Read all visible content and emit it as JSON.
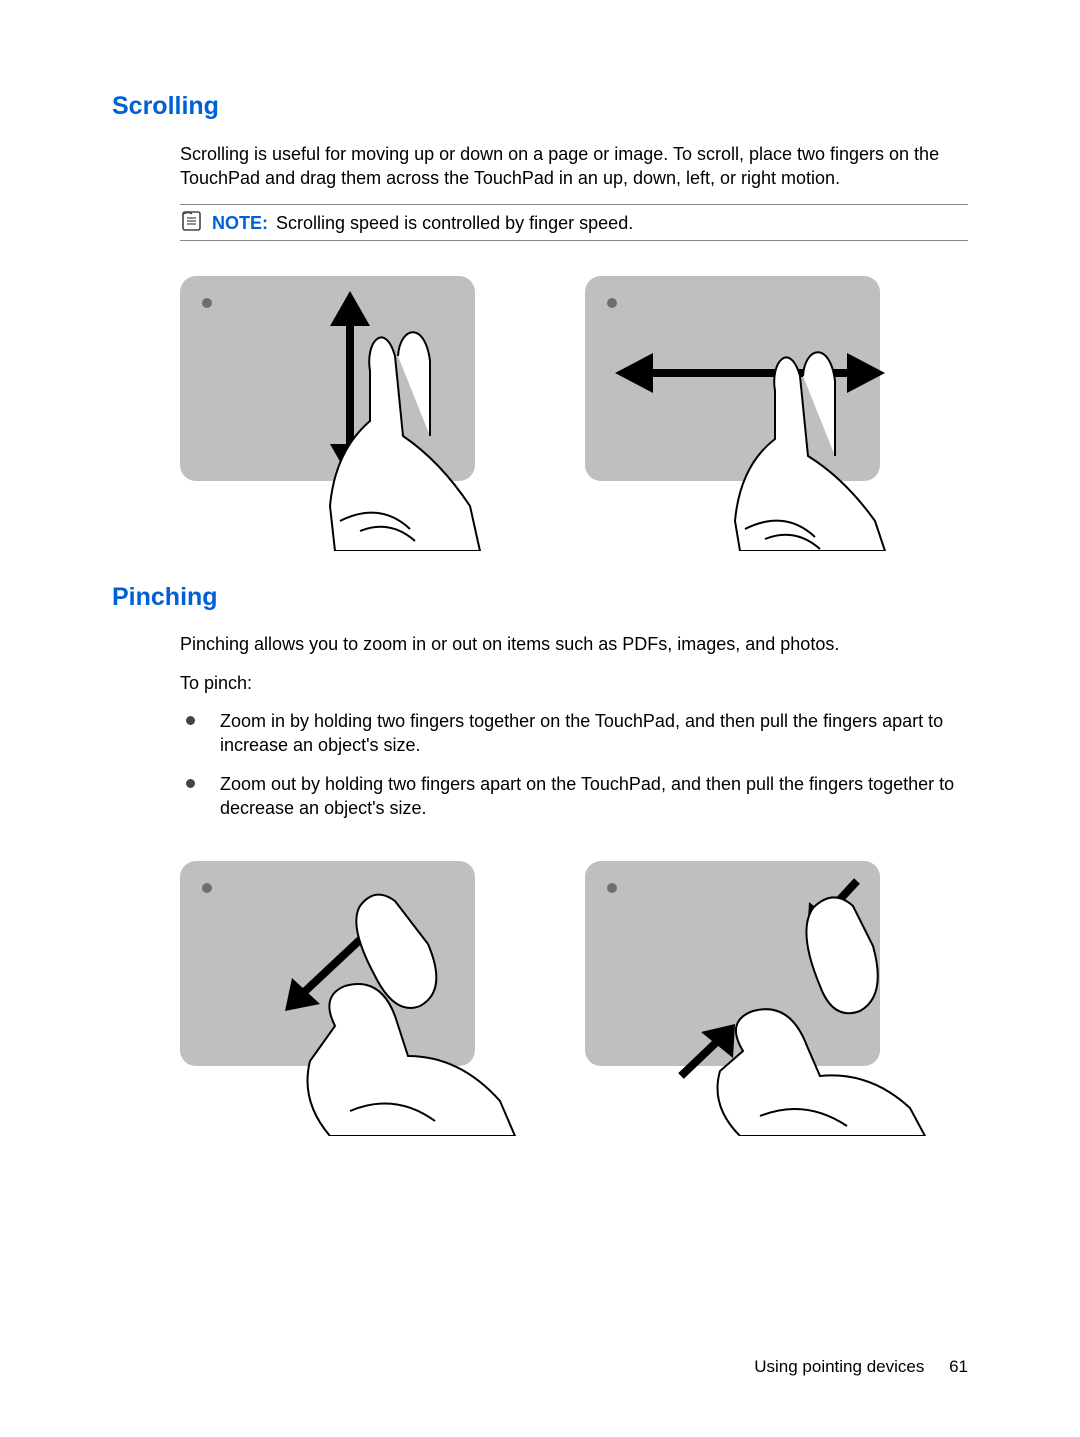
{
  "sections": {
    "scrolling": {
      "heading": "Scrolling",
      "paragraph": "Scrolling is useful for moving up or down on a page or image. To scroll, place two fingers on the TouchPad and drag them across the TouchPad in an up, down, left, or right motion.",
      "note_label": "NOTE:",
      "note_text": "Scrolling speed is controlled by finger speed."
    },
    "pinching": {
      "heading": "Pinching",
      "paragraph1": "Pinching allows you to zoom in or out on items such as PDFs, images, and photos.",
      "paragraph2": "To pinch:",
      "bullets": {
        "0": "Zoom in by holding two fingers together on the TouchPad, and then pull the fingers apart to increase an object's size.",
        "1": "Zoom out by holding two fingers apart on the TouchPad, and then pull the fingers together to decrease an object's size."
      }
    }
  },
  "footer": {
    "section_title": "Using pointing devices",
    "page_number": "61"
  }
}
